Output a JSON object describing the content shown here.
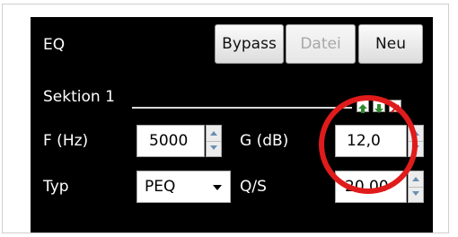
{
  "header": {
    "title": "EQ"
  },
  "toolbar": {
    "bypass_label": "Bypass",
    "datei_label": "Datei",
    "neu_label": "Neu"
  },
  "section": {
    "title": "Sektion 1"
  },
  "fields": {
    "freq": {
      "label": "F (Hz)",
      "value": "5000"
    },
    "gain": {
      "label": "G (dB)",
      "value": "12,0"
    },
    "type": {
      "label": "Typ",
      "value": "PEQ"
    },
    "q": {
      "label": "Q/S",
      "value": "20,00"
    }
  },
  "icons": [
    "arrow-up-icon",
    "arrow-down-icon",
    "close-icon"
  ],
  "colors": {
    "panel": "#000000",
    "annotation": "#e01b1b",
    "up": "#2e8b2e",
    "close": "#d32020"
  }
}
